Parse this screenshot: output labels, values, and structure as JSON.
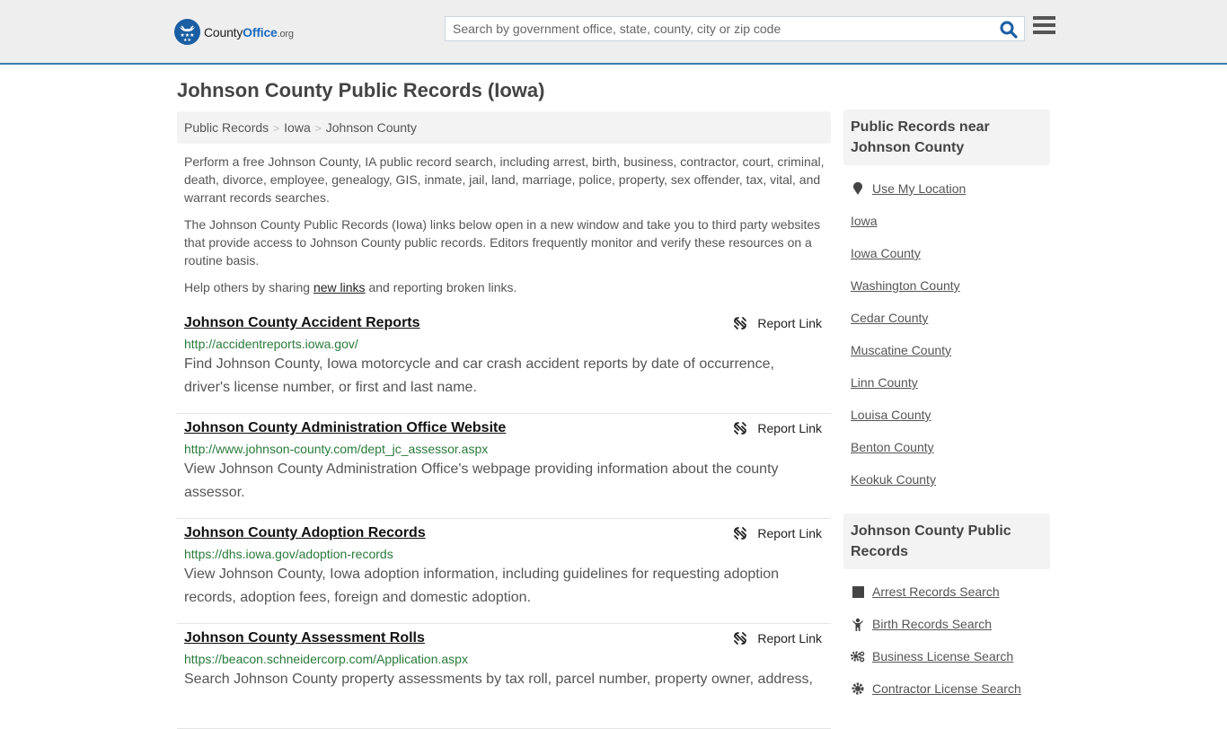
{
  "header": {
    "logo": {
      "brand_part1": "County",
      "brand_part2": "Office",
      "brand_suffix": ".org"
    },
    "search": {
      "placeholder": "Search by government office, state, county, city or zip code",
      "value": ""
    },
    "icons": {
      "search": "search-icon",
      "menu": "hamburger-menu-icon"
    }
  },
  "page": {
    "title": "Johnson County Public Records (Iowa)",
    "breadcrumb": [
      {
        "label": "Public Records"
      },
      {
        "label": "Iowa"
      },
      {
        "label": "Johnson County"
      }
    ],
    "breadcrumb_separator": ">",
    "intro": {
      "p1": "Perform a free Johnson County, IA public record search, including arrest, birth, business, contractor, court, criminal, death, divorce, employee, genealogy, GIS, inmate, jail, land, marriage, police, property, sex offender, tax, vital, and warrant records searches.",
      "p2": "The Johnson County Public Records (Iowa) links below open in a new window and take you to third party websites that provide access to Johnson County public records. Editors frequently monitor and verify these resources on a routine basis.",
      "p3_before": "Help others by sharing ",
      "p3_link": "new links",
      "p3_after": " and reporting broken links."
    }
  },
  "records": [
    {
      "title": "Johnson County Accident Reports",
      "url": "http://accidentreports.iowa.gov/",
      "description": "Find Johnson County, Iowa motorcycle and car crash accident reports by date of occurrence, driver's license number, or first and last name.",
      "report_label": "Report Link"
    },
    {
      "title": "Johnson County Administration Office Website",
      "url": "http://www.johnson-county.com/dept_jc_assessor.aspx",
      "description": "View Johnson County Administration Office's webpage providing information about the county assessor.",
      "report_label": "Report Link"
    },
    {
      "title": "Johnson County Adoption Records",
      "url": "https://dhs.iowa.gov/adoption-records",
      "description": "View Johnson County, Iowa adoption information, including guidelines for requesting adoption records, adoption fees, foreign and domestic adoption.",
      "report_label": "Report Link"
    },
    {
      "title": "Johnson County Assessment Rolls",
      "url": "https://beacon.schneidercorp.com/Application.aspx",
      "description": "Search Johnson County property assessments by tax roll, parcel number, property owner, address,",
      "report_label": "Report Link"
    }
  ],
  "sidebar": {
    "nearby": {
      "heading": "Public Records near Johnson County",
      "use_location": "Use My Location",
      "links": [
        "Iowa",
        "Iowa County",
        "Washington County",
        "Cedar County",
        "Muscatine County",
        "Linn County",
        "Louisa County",
        "Benton County",
        "Keokuk County"
      ]
    },
    "county_records": {
      "heading": "Johnson County Public Records",
      "links": [
        {
          "label": "Arrest Records Search",
          "icon": "square-icon"
        },
        {
          "label": "Birth Records Search",
          "icon": "child-icon"
        },
        {
          "label": "Business License Search",
          "icon": "gears-icon"
        },
        {
          "label": "Contractor License Search",
          "icon": "gear-icon"
        }
      ]
    }
  },
  "colors": {
    "header_bg": "#eeeeee",
    "header_border": "#3a7daf",
    "brand_blue": "#1a5ea3",
    "url_green": "#2a7a3a",
    "panel_bg": "#f3f3f3"
  }
}
